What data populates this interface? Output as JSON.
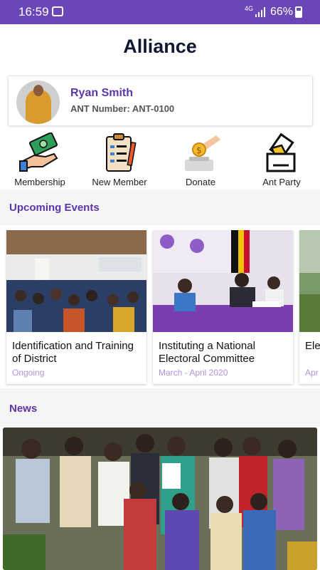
{
  "status_bar": {
    "time": "16:59",
    "network": "4G",
    "battery": "66%",
    "icons": [
      "wifi-icon",
      "signal-icon",
      "battery-icon"
    ]
  },
  "app": {
    "title": "Alliance"
  },
  "profile": {
    "name": "Ryan Smith",
    "ant_number": "ANT Number: ANT-0100"
  },
  "quick_actions": [
    {
      "label": "Membership",
      "icon": "money-hand-icon"
    },
    {
      "label": "New Member",
      "icon": "clipboard-form-icon"
    },
    {
      "label": "Donate",
      "icon": "coin-donation-icon"
    },
    {
      "label": "Ant Party",
      "icon": "ballot-box-icon"
    }
  ],
  "events": {
    "heading": "Upcoming Events",
    "items": [
      {
        "title": "Identification and Training of District",
        "date": "Ongoing"
      },
      {
        "title": "Instituting a National Electoral Committee",
        "date": "March - April 2020"
      },
      {
        "title": "Ele str",
        "date": "Apr"
      }
    ]
  },
  "news": {
    "heading": "News"
  },
  "colors": {
    "status_bar": "#6a46b8",
    "accent": "#5b35a9",
    "date_text": "#b492d9"
  }
}
